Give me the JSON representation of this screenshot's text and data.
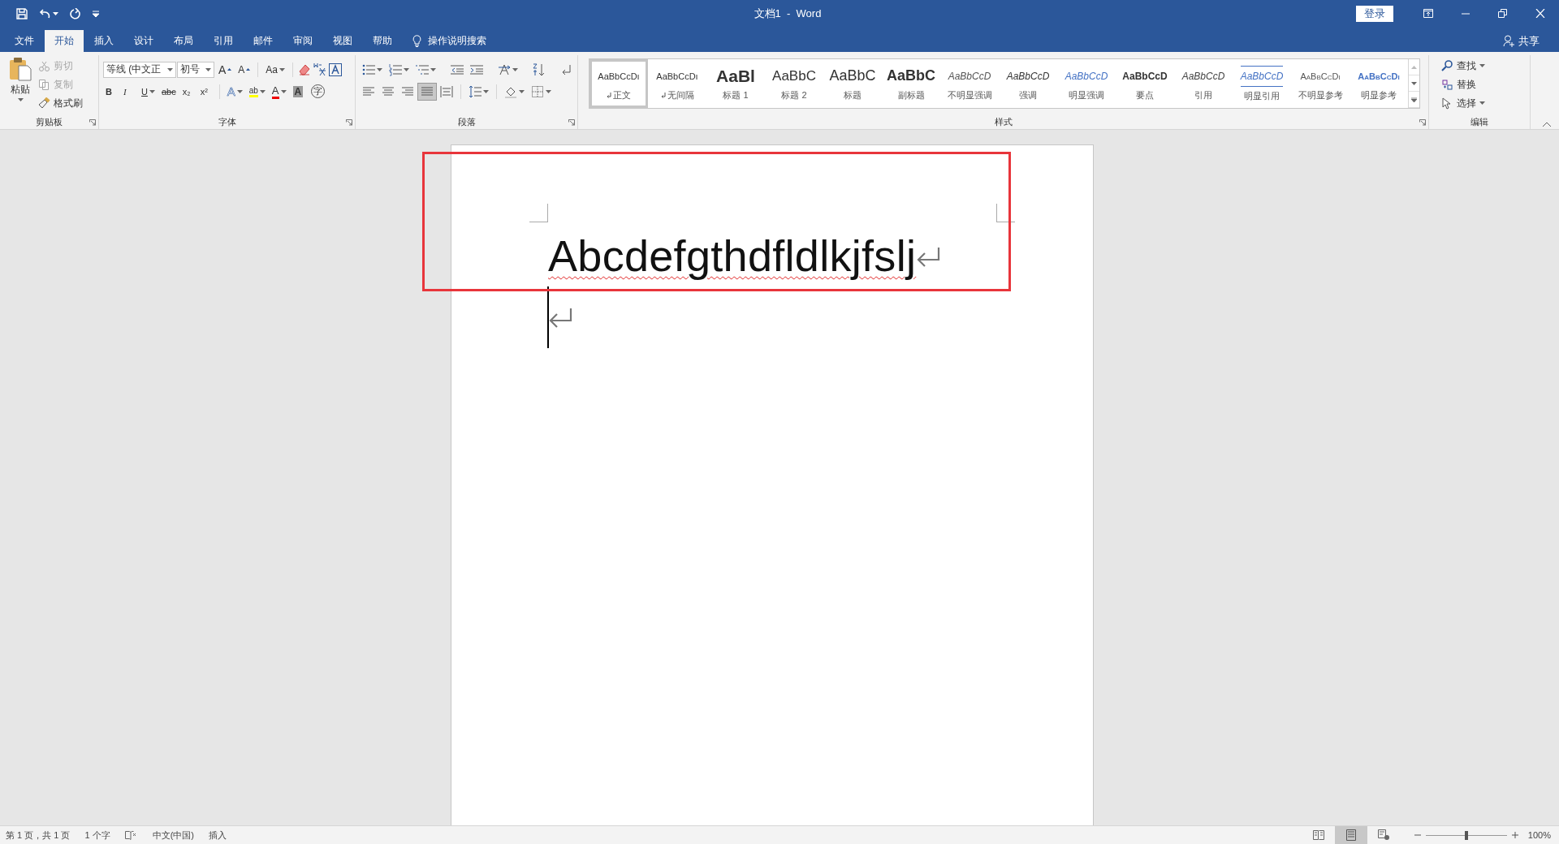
{
  "title_bar": {
    "title": "文档1  -  Word",
    "login": "登录"
  },
  "tabs": [
    {
      "label": "文件",
      "selected": false
    },
    {
      "label": "开始",
      "selected": true
    },
    {
      "label": "插入",
      "selected": false
    },
    {
      "label": "设计",
      "selected": false
    },
    {
      "label": "布局",
      "selected": false
    },
    {
      "label": "引用",
      "selected": false
    },
    {
      "label": "邮件",
      "selected": false
    },
    {
      "label": "审阅",
      "selected": false
    },
    {
      "label": "视图",
      "selected": false
    },
    {
      "label": "帮助",
      "selected": false
    }
  ],
  "tell_me": {
    "placeholder": "操作说明搜索"
  },
  "share": "共享",
  "clipboard": {
    "label": "剪贴板",
    "paste": "粘贴",
    "items": [
      {
        "kind": "cut",
        "label": "剪切",
        "disabled": true
      },
      {
        "kind": "copy",
        "label": "复制",
        "disabled": true
      },
      {
        "kind": "painter",
        "label": "格式刷",
        "disabled": false
      }
    ]
  },
  "font": {
    "label": "字体",
    "font_name": "等线 (中文正",
    "font_size": "初号",
    "row1": [
      {
        "kind": "grow",
        "label": "A"
      },
      {
        "kind": "shrink",
        "label": "A"
      },
      {
        "kind": "case",
        "label": "Aa"
      }
    ],
    "row2": [
      {
        "kind": "bold",
        "label": "B"
      },
      {
        "kind": "italic",
        "label": "I"
      },
      {
        "kind": "underline",
        "label": "U"
      },
      {
        "kind": "strike",
        "label": "abc"
      },
      {
        "kind": "sub",
        "label": "x₂"
      },
      {
        "kind": "sup",
        "label": "x²"
      }
    ],
    "row2b": [
      {
        "kind": "effects",
        "label": "A"
      },
      {
        "kind": "highlight",
        "label": "ab"
      },
      {
        "kind": "color",
        "label": "A"
      },
      {
        "kind": "shade",
        "label": "A"
      },
      {
        "kind": "enclose",
        "label": "字"
      }
    ]
  },
  "paragraph": {
    "label": "段落"
  },
  "styles": {
    "label": "样式",
    "items": [
      {
        "kind": "normal",
        "preview": "AaBbCcDı",
        "name": "正文",
        "selected": true,
        "paragraph_mark": true
      },
      {
        "kind": "normal",
        "preview": "AaBbCcDı",
        "name": "无间隔",
        "selected": false,
        "paragraph_mark": true
      },
      {
        "kind": "heading1",
        "preview": "AaBl",
        "name": "标题 1",
        "selected": false,
        "paragraph_mark": false
      },
      {
        "kind": "heading2",
        "preview": "AaBbC",
        "name": "标题 2",
        "selected": false,
        "paragraph_mark": false
      },
      {
        "kind": "title",
        "preview": "AaBbC",
        "name": "标题",
        "selected": false,
        "paragraph_mark": false
      },
      {
        "kind": "subtitle",
        "preview": "AaBbC",
        "name": "副标题",
        "selected": false,
        "paragraph_mark": false
      },
      {
        "kind": "subtle",
        "preview": "AaBbCcD",
        "name": "不明显强调",
        "selected": false,
        "paragraph_mark": false
      },
      {
        "kind": "emphasis",
        "preview": "AaBbCcD",
        "name": "强调",
        "selected": false,
        "paragraph_mark": false
      },
      {
        "kind": "intense",
        "preview": "AaBbCcD",
        "name": "明显强调",
        "selected": false,
        "paragraph_mark": false
      },
      {
        "kind": "strong",
        "preview": "AaBbCcD",
        "name": "要点",
        "selected": false,
        "paragraph_mark": false
      },
      {
        "kind": "quote",
        "preview": "AaBbCcD",
        "name": "引用",
        "selected": false,
        "paragraph_mark": false
      },
      {
        "kind": "intensequote",
        "preview": "AaBbCcD",
        "name": "明显引用",
        "selected": false,
        "paragraph_mark": false
      },
      {
        "kind": "subtleref",
        "preview": "AaBbCcDı",
        "name": "不明显参考",
        "selected": false,
        "paragraph_mark": false
      },
      {
        "kind": "intenseref",
        "preview": "AaBbCcDı",
        "name": "明显参考",
        "selected": false,
        "paragraph_mark": false
      }
    ]
  },
  "editing": {
    "label": "编辑",
    "items": [
      {
        "kind": "find",
        "label": "查找"
      },
      {
        "kind": "replace",
        "label": "替换"
      },
      {
        "kind": "select",
        "label": "选择"
      }
    ]
  },
  "document": {
    "paragraphs": [
      {
        "kind": "text",
        "text": "Abcdefgthdfldlkjfslj",
        "misspelled": true
      },
      {
        "kind": "empty",
        "cursor": true
      }
    ],
    "annotation": {
      "kind": "rectangle"
    }
  },
  "status_bar": {
    "page": "第 1 页，共 1 页",
    "words": "1 个字",
    "language": "中文(中国)",
    "mode": "插入",
    "views": [
      {
        "kind": "read",
        "selected": false
      },
      {
        "kind": "print",
        "selected": true
      },
      {
        "kind": "web",
        "selected": false
      }
    ],
    "zoom": {
      "level": 0.5,
      "value": "100%"
    }
  }
}
